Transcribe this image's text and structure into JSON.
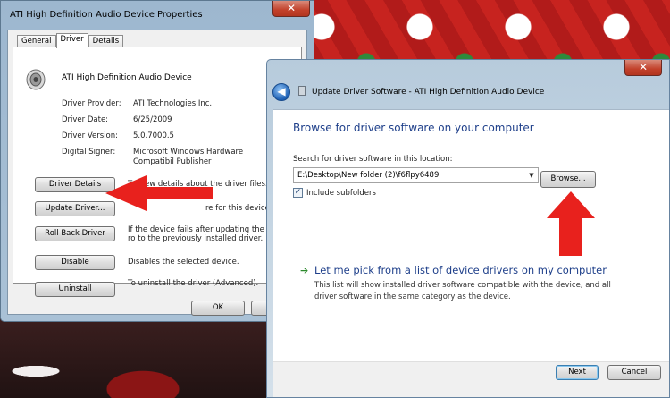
{
  "properties_window": {
    "title": "ATI High Definition Audio Device Properties",
    "close_glyph": "✕",
    "tabs": [
      {
        "label": "General",
        "active": false
      },
      {
        "label": "Driver",
        "active": true
      },
      {
        "label": "Details",
        "active": false
      }
    ],
    "device_name": "ATI High Definition Audio Device",
    "info": [
      {
        "label": "Driver Provider:",
        "value": "ATI Technologies Inc."
      },
      {
        "label": "Driver Date:",
        "value": "6/25/2009"
      },
      {
        "label": "Driver Version:",
        "value": "5.0.7000.5"
      },
      {
        "label": "Digital Signer:",
        "value": "Microsoft Windows Hardware Compatibil Publisher"
      }
    ],
    "buttons": [
      {
        "label": "Driver Details",
        "desc": "To view details about the driver files."
      },
      {
        "label": "Update Driver...",
        "desc": "re for this device"
      },
      {
        "label": "Roll Back Driver",
        "desc": "If the device fails after updating the driver, ro to the previously installed driver."
      },
      {
        "label": "Disable",
        "desc": "Disables the selected device."
      },
      {
        "label": "Uninstall",
        "desc": "To uninstall the driver (Advanced)."
      }
    ],
    "ok_label": "OK",
    "cancel_label": "Ca"
  },
  "update_window": {
    "title": "Update Driver Software - ATI High Definition Audio Device",
    "close_glyph": "✕",
    "back_glyph": "◀",
    "heading": "Browse for driver software on your computer",
    "search_label": "Search for driver software in this location:",
    "search_value": "E:\\Desktop\\New folder (2)\\f6flpy6489",
    "combo_arrow": "▼",
    "browse_label": "Browse...",
    "include_subfolders_label": "Include subfolders",
    "include_subfolders_checked": true,
    "check_glyph": "✓",
    "option_arrow": "➔",
    "option_title": "Let me pick from a list of device drivers on my computer",
    "option_desc": "This list will show installed driver software compatible with the device, and all driver software in the same category as the device.",
    "next_label": "Next",
    "cancel_label": "Cancel"
  },
  "annotation_color": "#e8211d"
}
